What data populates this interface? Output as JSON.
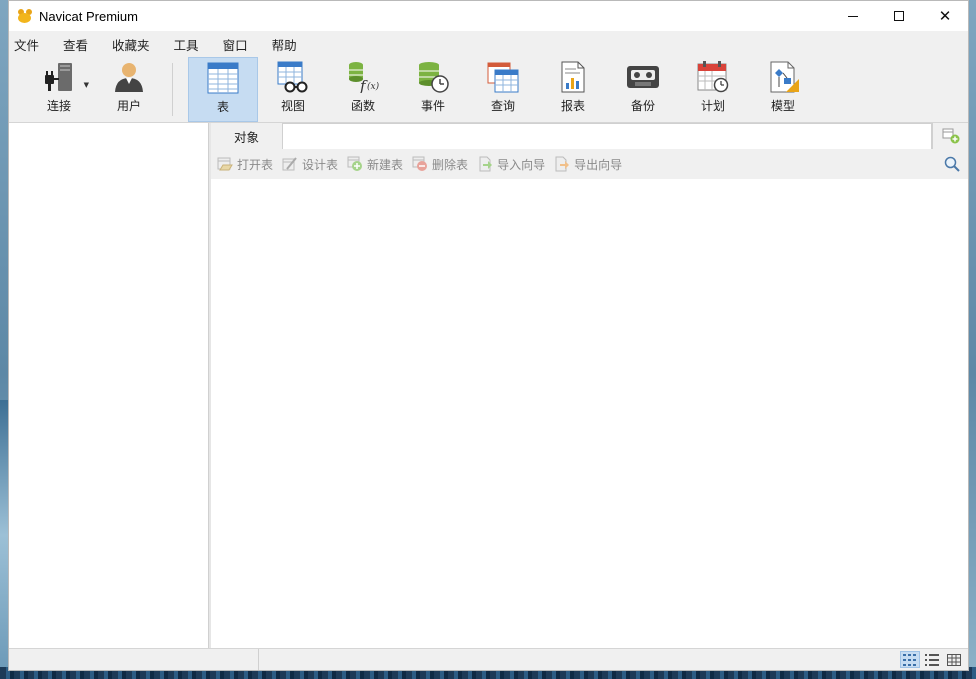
{
  "window": {
    "title": "Navicat Premium",
    "minimize_glyph": "",
    "close_glyph": "✕"
  },
  "menu": [
    "文件",
    "查看",
    "收藏夹",
    "工具",
    "窗口",
    "帮助"
  ],
  "toolbar": {
    "items": [
      {
        "label": "连接",
        "icon": "connection-plug-icon"
      },
      {
        "label": "用户",
        "icon": "user-icon"
      },
      {
        "label": "表",
        "icon": "table-icon",
        "active": true
      },
      {
        "label": "视图",
        "icon": "view-glasses-icon"
      },
      {
        "label": "函数",
        "icon": "function-icon"
      },
      {
        "label": "事件",
        "icon": "event-clock-icon"
      },
      {
        "label": "查询",
        "icon": "query-icon"
      },
      {
        "label": "报表",
        "icon": "report-icon"
      },
      {
        "label": "备份",
        "icon": "backup-tape-icon"
      },
      {
        "label": "计划",
        "icon": "schedule-calendar-icon"
      },
      {
        "label": "模型",
        "icon": "model-icon"
      }
    ]
  },
  "object_tab": {
    "label": "对象"
  },
  "actions": [
    {
      "label": "打开表",
      "icon": "open-table-icon"
    },
    {
      "label": "设计表",
      "icon": "design-table-icon"
    },
    {
      "label": "新建表",
      "icon": "new-table-icon"
    },
    {
      "label": "删除表",
      "icon": "delete-table-icon"
    },
    {
      "label": "导入向导",
      "icon": "import-wizard-icon"
    },
    {
      "label": "导出向导",
      "icon": "export-wizard-icon"
    }
  ],
  "colors": {
    "active_tool_bg": "#c6dcf2",
    "accent_orange": "#e9a417",
    "green": "#7cb342",
    "blue_grid": "#3a7bc8"
  }
}
